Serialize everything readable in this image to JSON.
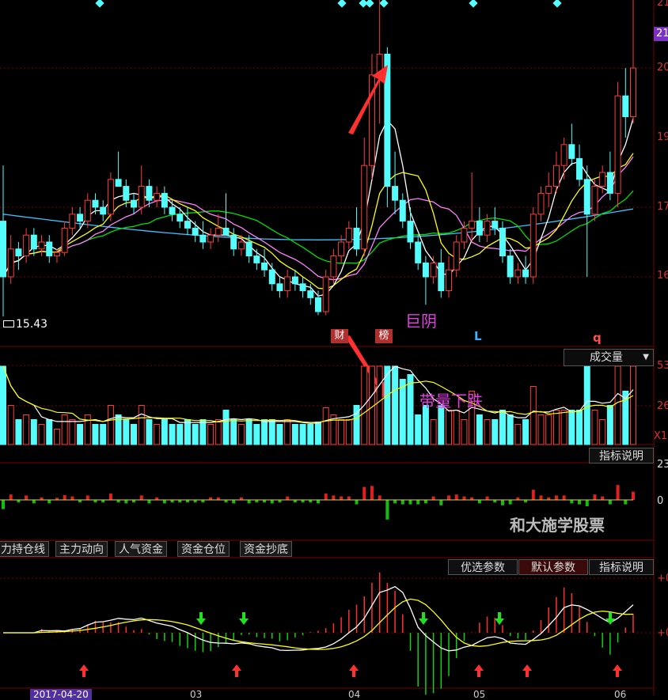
{
  "colors": {
    "up": "#ff3c3c",
    "down": "#54fcfc",
    "ma5": "#ffffff",
    "ma10": "#ffff00",
    "ma20": "#ff80ff",
    "ma30": "#00e000",
    "ma60": "#40c0ff",
    "grid": "#7a0000",
    "annot": "#e040e0",
    "arrow": "#ff3030"
  },
  "price_panel": {
    "low_label": "15.43",
    "right_ticks": [
      "21",
      "20",
      "19",
      "17",
      "16"
    ],
    "highlight_tick": "21",
    "tags": [
      "财",
      "榜",
      "L",
      "q"
    ],
    "annotation": "巨阴"
  },
  "volume_panel": {
    "title": "成交量",
    "ticks": [
      "53",
      "26",
      "X1"
    ],
    "annotation": "带量下跌",
    "indicator_btn": "指标说明"
  },
  "flow_panel": {
    "ticks": [
      "23",
      "0"
    ],
    "watermark": "和大施学股票"
  },
  "tabs": [
    "力持仓线",
    "主力动向",
    "人气资金",
    "资金仓位",
    "资金抄底"
  ],
  "macd_panel": {
    "buttons": [
      "优选参数",
      "默认参数",
      "指标说明"
    ],
    "ticks": [
      "+0",
      "+0"
    ]
  },
  "footer": {
    "date_labels": [
      "2017-04-20",
      "03",
      "04",
      "05",
      "06"
    ]
  },
  "chart_data": {
    "type": "candlestick",
    "candles": [
      [
        16.8,
        17.6,
        15.43,
        16.0
      ],
      [
        16.0,
        16.6,
        15.9,
        16.4
      ],
      [
        16.4,
        16.5,
        16.1,
        16.3
      ],
      [
        16.3,
        16.7,
        16.2,
        16.6
      ],
      [
        16.6,
        16.7,
        16.3,
        16.4
      ],
      [
        16.4,
        16.6,
        16.3,
        16.5
      ],
      [
        16.5,
        16.6,
        16.2,
        16.3
      ],
      [
        16.3,
        16.4,
        16.2,
        16.35
      ],
      [
        16.35,
        16.8,
        16.3,
        16.7
      ],
      [
        16.7,
        17.0,
        16.6,
        16.9
      ],
      [
        16.9,
        17.0,
        16.7,
        16.8
      ],
      [
        16.8,
        17.2,
        16.7,
        17.1
      ],
      [
        17.1,
        17.2,
        16.9,
        17.0
      ],
      [
        17.0,
        17.1,
        16.8,
        16.9
      ],
      [
        16.9,
        17.5,
        16.8,
        17.4
      ],
      [
        17.4,
        17.8,
        17.3,
        17.3
      ],
      [
        17.3,
        17.4,
        17.0,
        17.1
      ],
      [
        17.1,
        17.2,
        16.9,
        17.0
      ],
      [
        17.0,
        17.6,
        16.9,
        17.3
      ],
      [
        17.3,
        17.4,
        17.0,
        17.1
      ],
      [
        17.1,
        17.3,
        17.0,
        17.2
      ],
      [
        17.2,
        17.3,
        16.9,
        17.0
      ],
      [
        17.0,
        17.1,
        16.8,
        16.9
      ],
      [
        16.9,
        17.0,
        16.7,
        16.8
      ],
      [
        16.8,
        17.0,
        16.6,
        16.7
      ],
      [
        16.7,
        16.8,
        16.5,
        16.6
      ],
      [
        16.6,
        16.8,
        16.4,
        16.5
      ],
      [
        16.5,
        16.7,
        16.4,
        16.6
      ],
      [
        16.6,
        16.9,
        16.5,
        16.7
      ],
      [
        16.7,
        17.2,
        16.6,
        16.6
      ],
      [
        16.6,
        16.7,
        16.3,
        16.4
      ],
      [
        16.4,
        16.6,
        16.3,
        16.5
      ],
      [
        16.5,
        16.6,
        16.2,
        16.3
      ],
      [
        16.3,
        16.4,
        16.1,
        16.2
      ],
      [
        16.2,
        16.4,
        16.0,
        16.1
      ],
      [
        16.1,
        16.2,
        15.8,
        15.9
      ],
      [
        15.9,
        16.0,
        15.7,
        15.8
      ],
      [
        15.8,
        16.1,
        15.7,
        16.0
      ],
      [
        16.0,
        16.1,
        15.8,
        15.9
      ],
      [
        15.9,
        16.0,
        15.7,
        15.8
      ],
      [
        15.8,
        15.9,
        15.6,
        15.7
      ],
      [
        15.7,
        15.8,
        15.45,
        15.5
      ],
      [
        15.5,
        16.1,
        15.45,
        16.0
      ],
      [
        16.0,
        16.4,
        15.9,
        16.3
      ],
      [
        16.3,
        16.6,
        16.2,
        16.5
      ],
      [
        16.5,
        16.8,
        16.4,
        16.7
      ],
      [
        16.7,
        17.0,
        16.3,
        16.4
      ],
      [
        16.4,
        18.0,
        16.3,
        17.6
      ],
      [
        17.6,
        19.2,
        17.4,
        18.9
      ],
      [
        18.9,
        20.8,
        18.2,
        19.2
      ],
      [
        19.2,
        19.3,
        17.0,
        17.3
      ],
      [
        17.3,
        17.8,
        16.9,
        17.1
      ],
      [
        17.1,
        17.2,
        16.7,
        16.8
      ],
      [
        16.8,
        17.0,
        16.4,
        16.5
      ],
      [
        16.5,
        16.6,
        16.1,
        16.2
      ],
      [
        16.2,
        16.3,
        15.6,
        16.0
      ],
      [
        16.0,
        16.3,
        15.9,
        16.2
      ],
      [
        16.2,
        16.4,
        15.7,
        15.8
      ],
      [
        15.8,
        16.3,
        15.7,
        16.1
      ],
      [
        16.1,
        16.6,
        16.0,
        16.5
      ],
      [
        16.5,
        16.8,
        16.4,
        16.7
      ],
      [
        16.7,
        17.5,
        16.5,
        16.8
      ],
      [
        16.8,
        17.0,
        16.5,
        16.6
      ],
      [
        16.6,
        16.9,
        16.5,
        16.8
      ],
      [
        16.8,
        17.0,
        16.6,
        16.7
      ],
      [
        16.7,
        16.8,
        16.2,
        16.3
      ],
      [
        16.3,
        16.4,
        15.9,
        16.0
      ],
      [
        16.0,
        16.2,
        15.9,
        16.1
      ],
      [
        16.1,
        16.3,
        15.9,
        16.0
      ],
      [
        16.0,
        17.0,
        15.9,
        16.9
      ],
      [
        16.9,
        17.3,
        16.8,
        17.2
      ],
      [
        17.2,
        17.5,
        17.0,
        17.3
      ],
      [
        17.3,
        17.8,
        17.2,
        17.6
      ],
      [
        17.6,
        18.0,
        17.4,
        17.9
      ],
      [
        17.9,
        18.2,
        17.6,
        17.7
      ],
      [
        17.7,
        17.9,
        17.3,
        17.4
      ],
      [
        17.4,
        17.6,
        16.0,
        16.9
      ],
      [
        16.9,
        17.4,
        16.8,
        17.3
      ],
      [
        17.3,
        17.6,
        17.2,
        17.5
      ],
      [
        17.5,
        17.8,
        17.1,
        17.2
      ],
      [
        17.2,
        18.8,
        17.0,
        18.6
      ],
      [
        18.6,
        19.0,
        18.0,
        18.3
      ],
      [
        18.3,
        20.3,
        18.2,
        19.0
      ]
    ]
  }
}
